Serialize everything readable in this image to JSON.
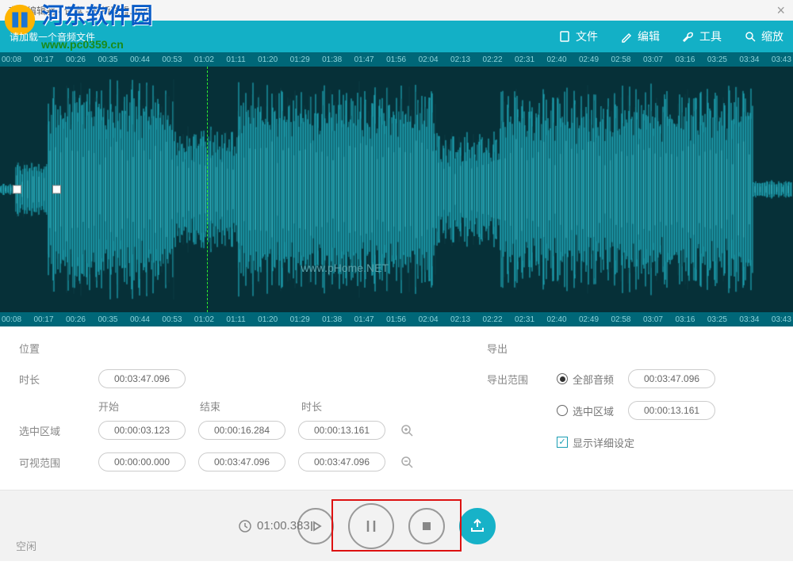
{
  "window": {
    "title": "音频编辑器 - 许嵩 - 断桥残雪.mp3"
  },
  "hint": "请加载一个音频文件",
  "menus": {
    "file": "文件",
    "edit": "编辑",
    "tool": "工具",
    "zoom": "缩放"
  },
  "timeline_ticks": [
    "00:08",
    "00:17",
    "00:26",
    "00:35",
    "00:44",
    "00:53",
    "01:02",
    "01:11",
    "01:20",
    "01:29",
    "01:38",
    "01:47",
    "01:56",
    "02:04",
    "02:13",
    "02:22",
    "02:31",
    "02:40",
    "02:49",
    "02:58",
    "03:07",
    "03:16",
    "03:25",
    "03:34",
    "03:43"
  ],
  "position": {
    "title": "位置",
    "duration_label": "时长",
    "duration_value": "00:03:47.096",
    "headers": {
      "start": "开始",
      "end": "结束",
      "length": "时长"
    },
    "selection_label": "选中区域",
    "selection": {
      "start": "00:00:03.123",
      "end": "00:00:16.284",
      "length": "00:00:13.161"
    },
    "visible_label": "可视范围",
    "visible": {
      "start": "00:00:00.000",
      "end": "00:03:47.096",
      "length": "00:03:47.096"
    }
  },
  "export": {
    "title": "导出",
    "range_label": "导出范围",
    "opt_all": "全部音频",
    "opt_all_value": "00:03:47.096",
    "opt_sel": "选中区域",
    "opt_sel_value": "00:00:13.161",
    "show_detail": "显示详细设定"
  },
  "transport": {
    "time": "01:00.383"
  },
  "status": "空闲",
  "watermark": {
    "site_cn": "河东软件园",
    "site_url": "www.pc0359.cn",
    "phome": "www.pHome.NET"
  }
}
